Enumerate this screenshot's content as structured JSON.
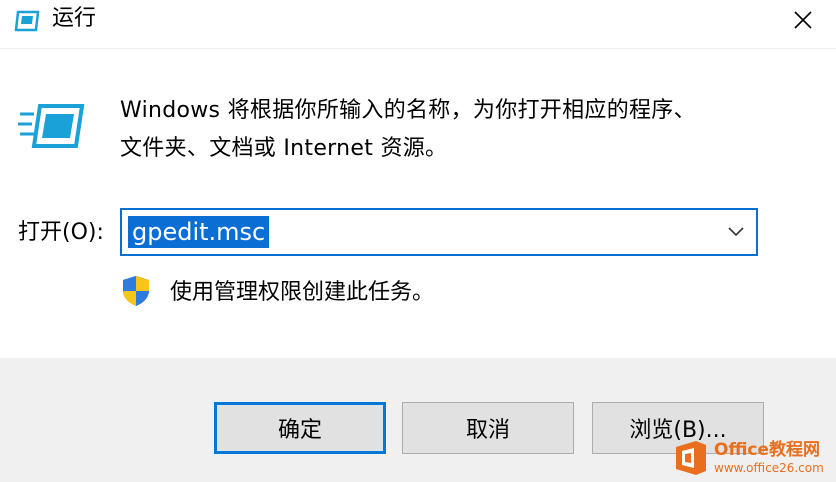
{
  "window": {
    "title": "运行",
    "app_icon": "run-dialog-icon",
    "close_icon": "close-icon"
  },
  "dialog": {
    "description_line1": "Windows 将根据你所输入的名称，为你打开相应的程序、",
    "description_line2": "文件夹、文档或 Internet 资源。",
    "open_label": "打开(O):",
    "open_value": "gpedit.msc",
    "admin_note": "使用管理权限创建此任务。",
    "shield_icon": "uac-shield-icon"
  },
  "buttons": {
    "ok": "确定",
    "cancel": "取消",
    "browse": "浏览(B)..."
  },
  "watermark": {
    "brand": "Office教程网",
    "url": "www.office26.com"
  },
  "colors": {
    "accent": "#0078d7",
    "selection": "#0a6ed4",
    "footer_bg": "#f0f0f0",
    "watermark": "#e86f1d"
  }
}
